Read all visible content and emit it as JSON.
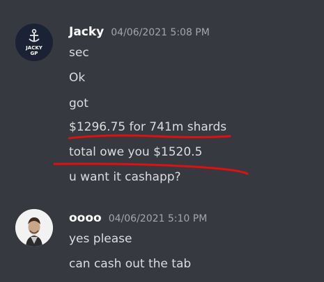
{
  "messages": [
    {
      "author": "Jacky",
      "timestamp": "04/06/2021 5:08 PM",
      "avatar_text": [
        "JACKY",
        "GP"
      ],
      "lines": [
        "sec",
        "Ok",
        "got",
        "$1296.75 for 741m shards",
        "total owe you $1520.5",
        "u want it cashapp?"
      ]
    },
    {
      "author": "oooo",
      "timestamp": "04/06/2021 5:10 PM",
      "lines": [
        "yes please",
        "can cash out the tab"
      ]
    }
  ],
  "colors": {
    "background": "#36393f",
    "author": "#ffffff",
    "text": "#dcddde",
    "timestamp": "#a3a6aa",
    "annotation": "#e01010"
  }
}
